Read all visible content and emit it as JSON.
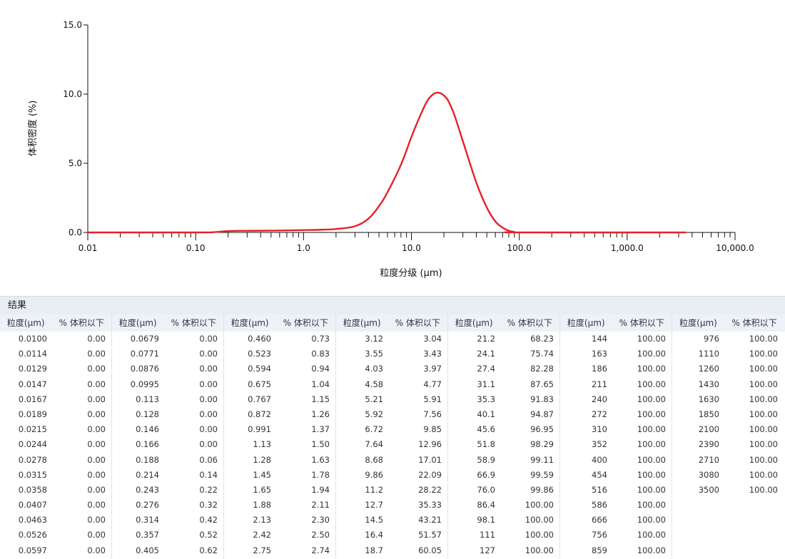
{
  "chart_data": {
    "type": "line",
    "xscale": "log",
    "xlim": [
      0.01,
      10000
    ],
    "ylim": [
      0,
      15
    ],
    "xlabel": "粒度分级 (µm)",
    "ylabel": "体积密度 (%)",
    "xticks": [
      "0.01",
      "0.10",
      "1.0",
      "10.0",
      "100.0",
      "1,000.0",
      "10,000.0"
    ],
    "yticks": [
      "0.0",
      "5.0",
      "10.0",
      "15.0"
    ],
    "series": [
      {
        "color": "#e8202a",
        "x": [
          0.01,
          0.1,
          0.15,
          0.2,
          0.3,
          0.5,
          1.0,
          1.5,
          2.0,
          3.0,
          4.0,
          5.0,
          6.0,
          8.0,
          10.0,
          12.0,
          14.0,
          16.0,
          18.0,
          20.0,
          22.0,
          25.0,
          30.0,
          40.0,
          50.0,
          60.0,
          70.0,
          80.0,
          90.0,
          100.0,
          3500.0
        ],
        "y": [
          0.0,
          0.0,
          0.02,
          0.1,
          0.12,
          0.13,
          0.17,
          0.2,
          0.25,
          0.45,
          1.0,
          1.9,
          2.9,
          4.9,
          6.9,
          8.4,
          9.5,
          10.0,
          10.1,
          9.9,
          9.5,
          8.5,
          6.6,
          3.6,
          1.8,
          0.8,
          0.35,
          0.12,
          0.04,
          0.0,
          0.0
        ]
      }
    ]
  },
  "results": {
    "title": "结果",
    "col_size": "粒度(µm)",
    "col_pct": "% 体积以下",
    "groups": [
      [
        [
          "0.0100",
          "0.00"
        ],
        [
          "0.0114",
          "0.00"
        ],
        [
          "0.0129",
          "0.00"
        ],
        [
          "0.0147",
          "0.00"
        ],
        [
          "0.0167",
          "0.00"
        ],
        [
          "0.0189",
          "0.00"
        ],
        [
          "0.0215",
          "0.00"
        ],
        [
          "0.0244",
          "0.00"
        ],
        [
          "0.0278",
          "0.00"
        ],
        [
          "0.0315",
          "0.00"
        ],
        [
          "0.0358",
          "0.00"
        ],
        [
          "0.0407",
          "0.00"
        ],
        [
          "0.0463",
          "0.00"
        ],
        [
          "0.0526",
          "0.00"
        ],
        [
          "0.0597",
          "0.00"
        ]
      ],
      [
        [
          "0.0679",
          "0.00"
        ],
        [
          "0.0771",
          "0.00"
        ],
        [
          "0.0876",
          "0.00"
        ],
        [
          "0.0995",
          "0.00"
        ],
        [
          "0.113",
          "0.00"
        ],
        [
          "0.128",
          "0.00"
        ],
        [
          "0.146",
          "0.00"
        ],
        [
          "0.166",
          "0.00"
        ],
        [
          "0.188",
          "0.06"
        ],
        [
          "0.214",
          "0.14"
        ],
        [
          "0.243",
          "0.22"
        ],
        [
          "0.276",
          "0.32"
        ],
        [
          "0.314",
          "0.42"
        ],
        [
          "0.357",
          "0.52"
        ],
        [
          "0.405",
          "0.62"
        ]
      ],
      [
        [
          "0.460",
          "0.73"
        ],
        [
          "0.523",
          "0.83"
        ],
        [
          "0.594",
          "0.94"
        ],
        [
          "0.675",
          "1.04"
        ],
        [
          "0.767",
          "1.15"
        ],
        [
          "0.872",
          "1.26"
        ],
        [
          "0.991",
          "1.37"
        ],
        [
          "1.13",
          "1.50"
        ],
        [
          "1.28",
          "1.63"
        ],
        [
          "1.45",
          "1.78"
        ],
        [
          "1.65",
          "1.94"
        ],
        [
          "1.88",
          "2.11"
        ],
        [
          "2.13",
          "2.30"
        ],
        [
          "2.42",
          "2.50"
        ],
        [
          "2.75",
          "2.74"
        ]
      ],
      [
        [
          "3.12",
          "3.04"
        ],
        [
          "3.55",
          "3.43"
        ],
        [
          "4.03",
          "3.97"
        ],
        [
          "4.58",
          "4.77"
        ],
        [
          "5.21",
          "5.91"
        ],
        [
          "5.92",
          "7.56"
        ],
        [
          "6.72",
          "9.85"
        ],
        [
          "7.64",
          "12.96"
        ],
        [
          "8.68",
          "17.01"
        ],
        [
          "9.86",
          "22.09"
        ],
        [
          "11.2",
          "28.22"
        ],
        [
          "12.7",
          "35.33"
        ],
        [
          "14.5",
          "43.21"
        ],
        [
          "16.4",
          "51.57"
        ],
        [
          "18.7",
          "60.05"
        ]
      ],
      [
        [
          "21.2",
          "68.23"
        ],
        [
          "24.1",
          "75.74"
        ],
        [
          "27.4",
          "82.28"
        ],
        [
          "31.1",
          "87.65"
        ],
        [
          "35.3",
          "91.83"
        ],
        [
          "40.1",
          "94.87"
        ],
        [
          "45.6",
          "96.95"
        ],
        [
          "51.8",
          "98.29"
        ],
        [
          "58.9",
          "99.11"
        ],
        [
          "66.9",
          "99.59"
        ],
        [
          "76.0",
          "99.86"
        ],
        [
          "86.4",
          "100.00"
        ],
        [
          "98.1",
          "100.00"
        ],
        [
          "111",
          "100.00"
        ],
        [
          "127",
          "100.00"
        ]
      ],
      [
        [
          "144",
          "100.00"
        ],
        [
          "163",
          "100.00"
        ],
        [
          "186",
          "100.00"
        ],
        [
          "211",
          "100.00"
        ],
        [
          "240",
          "100.00"
        ],
        [
          "272",
          "100.00"
        ],
        [
          "310",
          "100.00"
        ],
        [
          "352",
          "100.00"
        ],
        [
          "400",
          "100.00"
        ],
        [
          "454",
          "100.00"
        ],
        [
          "516",
          "100.00"
        ],
        [
          "586",
          "100.00"
        ],
        [
          "666",
          "100.00"
        ],
        [
          "756",
          "100.00"
        ],
        [
          "859",
          "100.00"
        ]
      ],
      [
        [
          "976",
          "100.00"
        ],
        [
          "1110",
          "100.00"
        ],
        [
          "1260",
          "100.00"
        ],
        [
          "1430",
          "100.00"
        ],
        [
          "1630",
          "100.00"
        ],
        [
          "1850",
          "100.00"
        ],
        [
          "2100",
          "100.00"
        ],
        [
          "2390",
          "100.00"
        ],
        [
          "2710",
          "100.00"
        ],
        [
          "3080",
          "100.00"
        ],
        [
          "3500",
          "100.00"
        ]
      ]
    ]
  }
}
